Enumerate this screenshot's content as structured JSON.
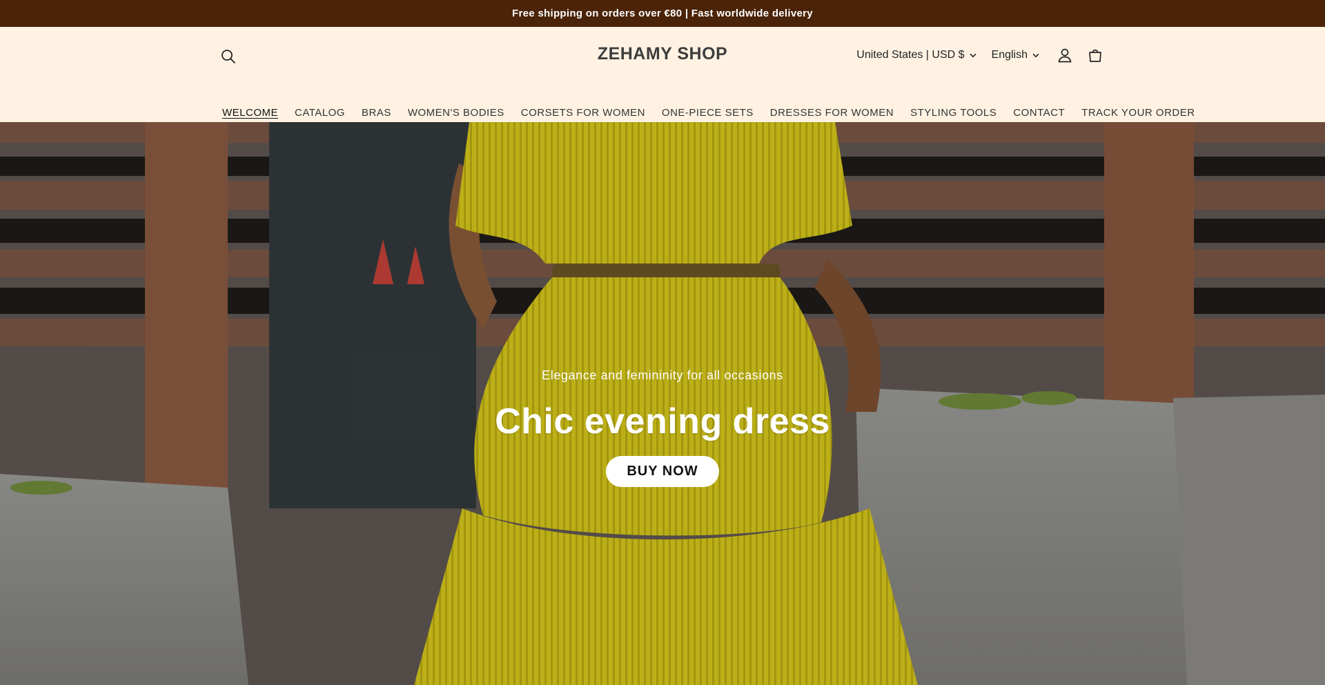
{
  "announcement": {
    "text": "Free shipping on orders over €80 | Fast worldwide delivery"
  },
  "header": {
    "logo": "ZEHAMY SHOP",
    "country_selector": "United States | USD $",
    "language_selector": "English"
  },
  "nav": {
    "items": [
      {
        "label": "WELCOME",
        "active": true
      },
      {
        "label": "CATALOG"
      },
      {
        "label": "BRAS"
      },
      {
        "label": "WOMEN'S BODIES"
      },
      {
        "label": "CORSETS FOR WOMEN"
      },
      {
        "label": "ONE-PIECE SETS"
      },
      {
        "label": "DRESSES FOR WOMEN"
      },
      {
        "label": "STYLING TOOLS"
      },
      {
        "label": "CONTACT"
      },
      {
        "label": "TRACK YOUR ORDER"
      }
    ]
  },
  "hero": {
    "subtitle": "Elegance and femininity for all occasions",
    "title": "Chic evening dress",
    "button_label": "BUY NOW"
  },
  "icons": {
    "search": "search-icon",
    "account": "user-icon",
    "cart": "cart-icon",
    "chevron": "chevron-down-icon"
  },
  "colors": {
    "announcement_bg": "#4a2308",
    "header_bg": "#fff2e3",
    "dress_yellow": "#d9c91a"
  }
}
